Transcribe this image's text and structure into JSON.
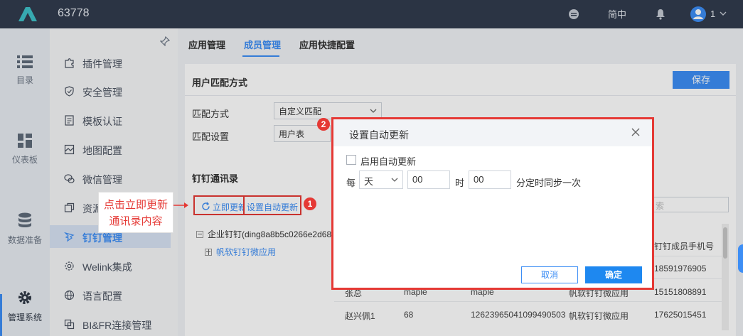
{
  "header": {
    "app_title": "63778",
    "language": "简中",
    "user_count": "1"
  },
  "rail": [
    {
      "label": "目录"
    },
    {
      "label": "仪表板"
    },
    {
      "label": "数据准备"
    },
    {
      "label": "管理系统"
    }
  ],
  "sidenav": [
    {
      "label": "插件管理"
    },
    {
      "label": "安全管理"
    },
    {
      "label": "模板认证"
    },
    {
      "label": "地图配置"
    },
    {
      "label": "微信管理"
    },
    {
      "label": "资源"
    },
    {
      "label": "钉钉管理"
    },
    {
      "label": "Welink集成"
    },
    {
      "label": "语言配置"
    },
    {
      "label": "BI&FR连接管理"
    }
  ],
  "tabs": [
    {
      "label": "应用管理"
    },
    {
      "label": "成员管理"
    },
    {
      "label": "应用快捷配置"
    }
  ],
  "match_panel": {
    "title": "用户匹配方式",
    "save_label": "保存",
    "method_label": "匹配方式",
    "method_value": "自定义匹配",
    "setting_label": "匹配设置",
    "setting_value": "用户表"
  },
  "contacts_panel": {
    "title": "钉钉通讯录",
    "update_now_label": "立即更新",
    "auto_update_label": "设置自动更新",
    "search_placeholder": "索",
    "tree_root": "企业钉钉(ding8a8b5c0266e2d68",
    "tree_child": "帆软钉钉微应用",
    "column_phone": "钉钉成员手机号",
    "rows": [
      {
        "name": "",
        "id": "",
        "user": "",
        "app": "",
        "phone": "18591976905"
      },
      {
        "name": "张总",
        "id": "maple",
        "user": "maple",
        "app": "帆软钉钉微应用",
        "phone": "15151808891"
      },
      {
        "name": "赵兴佩1",
        "id": "68",
        "user": "12623965041099490503",
        "app": "帆软钉钉微应用",
        "phone": "17625015451"
      }
    ]
  },
  "dialog": {
    "title": "设置自动更新",
    "enable_label": "启用自动更新",
    "freq_prefix": "每",
    "unit_value": "天",
    "hour_value": "00",
    "hour_suffix": "时",
    "minute_value": "00",
    "minute_suffix": "分定时同步一次",
    "cancel_label": "取消",
    "ok_label": "确定"
  },
  "annotations": {
    "marker1": "1",
    "marker2": "2",
    "callout_line1": "点击立即更新",
    "callout_line2": "通讯录内容"
  },
  "colors": {
    "accent": "#3d8ef5",
    "topbar": "#323c4e",
    "highlight": "#e53935"
  }
}
